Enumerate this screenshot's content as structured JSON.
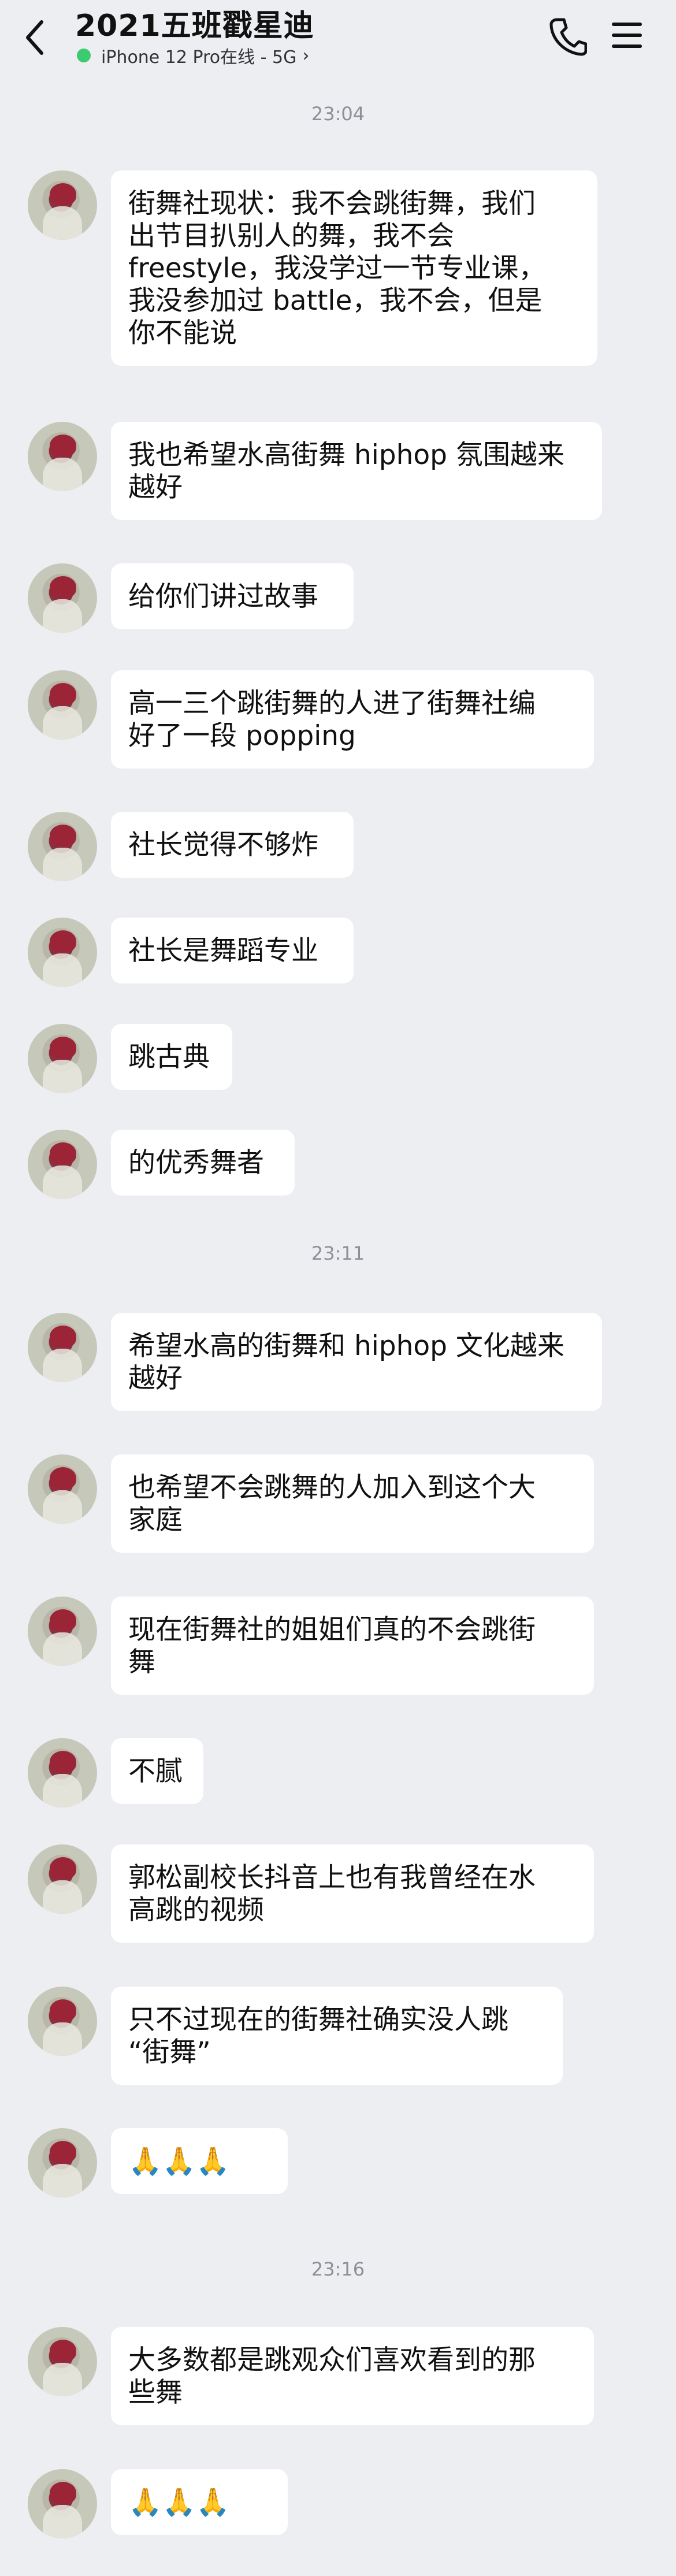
{
  "header": {
    "title": "2021五班戳星迪",
    "subtitle": "iPhone 12 Pro在线 - 5G",
    "status_color": "#3ccc6f"
  },
  "times": [
    "23:04",
    "23:11",
    "23:16"
  ],
  "messages": [
    {
      "lines": [
        "街舞社现状：我不会跳街舞，我们",
        "出节目扒别人的舞，我不会",
        "freestyle，我没学过一节专业课，",
        "我没参加过 battle，我不会，但是",
        "你不能说"
      ]
    },
    {
      "lines": [
        "我也希望水高街舞 hiphop 氛围越来",
        "越好"
      ]
    },
    {
      "lines": [
        "给你们讲过故事"
      ]
    },
    {
      "lines": [
        "高一三个跳街舞的人进了街舞社编",
        "好了一段 popping"
      ]
    },
    {
      "lines": [
        "社长觉得不够炸"
      ]
    },
    {
      "lines": [
        "社长是舞蹈专业"
      ]
    },
    {
      "lines": [
        "跳古典"
      ]
    },
    {
      "lines": [
        "的优秀舞者"
      ]
    },
    {
      "lines": [
        "希望水高的街舞和 hiphop 文化越来",
        "越好"
      ]
    },
    {
      "lines": [
        "也希望不会跳舞的人加入到这个大",
        "家庭"
      ]
    },
    {
      "lines": [
        "现在街舞社的姐姐们真的不会跳街",
        "舞"
      ]
    },
    {
      "lines": [
        "不腻"
      ]
    },
    {
      "lines": [
        "郭松副校长抖音上也有我曾经在水",
        "高跳的视频"
      ]
    },
    {
      "lines": [
        "只不过现在的街舞社确实没人跳",
        "“街舞”"
      ]
    },
    {
      "lines": [
        "🙏🙏🙏"
      ]
    },
    {
      "lines": [
        "大多数都是跳观众们喜欢看到的那",
        "些舞"
      ]
    },
    {
      "lines": [
        "🙏🙏🙏"
      ]
    }
  ]
}
